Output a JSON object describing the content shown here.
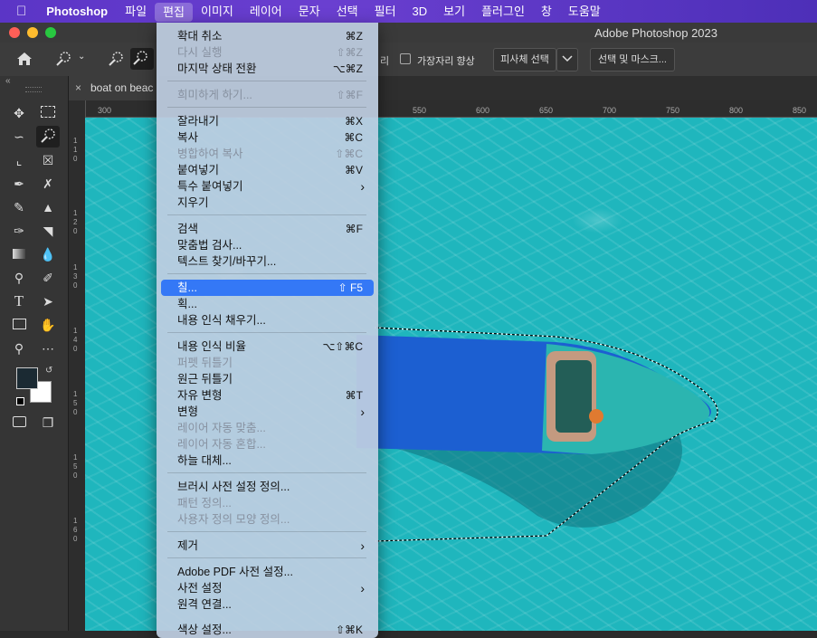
{
  "menubar": {
    "app": "Photoshop",
    "items": [
      "파일",
      "편집",
      "이미지",
      "레이어",
      "문자",
      "선택",
      "필터",
      "3D",
      "보기",
      "플러그인",
      "창",
      "도움말"
    ]
  },
  "window": {
    "title": "Adobe Photoshop 2023"
  },
  "options": {
    "fragment_left": "리",
    "checkbox_label": "가장자리 향상",
    "subject_button": "피사체 선택",
    "mask_button": "선택 및 마스크..."
  },
  "document": {
    "tab_title": "boat on beac",
    "ruler_ticks": [
      "300",
      "550",
      "600",
      "650",
      "700",
      "750",
      "800",
      "850"
    ],
    "left_ruler": [
      "1",
      "1",
      "0",
      "1",
      "2",
      "0",
      "1",
      "3",
      "0",
      "1",
      "4",
      "0",
      "1",
      "5",
      "0",
      "1",
      "5",
      "0",
      "1",
      "6",
      "0"
    ]
  },
  "edit_menu": {
    "items": [
      {
        "label": "확대 취소",
        "shortcut": "⌘Z",
        "disabled": false
      },
      {
        "label": "다시 실행",
        "shortcut": "⇧⌘Z",
        "disabled": true
      },
      {
        "label": "마지막 상태 전환",
        "shortcut": "⌥⌘Z",
        "disabled": false
      },
      {
        "label": "희미하게 하기...",
        "shortcut": "⇧⌘F",
        "disabled": true
      },
      {
        "label": "잘라내기",
        "shortcut": "⌘X",
        "disabled": false
      },
      {
        "label": "복사",
        "shortcut": "⌘C",
        "disabled": false
      },
      {
        "label": "병합하여 복사",
        "shortcut": "⇧⌘C",
        "disabled": true
      },
      {
        "label": "붙여넣기",
        "shortcut": "⌘V",
        "disabled": false
      },
      {
        "label": "특수 붙여넣기",
        "shortcut": "",
        "submenu": true,
        "disabled": false
      },
      {
        "label": "지우기",
        "shortcut": "",
        "disabled": false
      },
      {
        "label": "검색",
        "shortcut": "⌘F",
        "disabled": false
      },
      {
        "label": "맞춤법 검사...",
        "shortcut": "",
        "disabled": false
      },
      {
        "label": "텍스트 찾기/바꾸기...",
        "shortcut": "",
        "disabled": false
      },
      {
        "label": "칠...",
        "shortcut": "⇧ F5",
        "disabled": false,
        "highlighted": true
      },
      {
        "label": "획...",
        "shortcut": "",
        "disabled": false
      },
      {
        "label": "내용 인식 채우기...",
        "shortcut": "",
        "disabled": false
      },
      {
        "label": "내용 인식 비율",
        "shortcut": "⌥⇧⌘C",
        "disabled": false
      },
      {
        "label": "퍼펫 뒤틀기",
        "shortcut": "",
        "disabled": true
      },
      {
        "label": "원근 뒤틀기",
        "shortcut": "",
        "disabled": false
      },
      {
        "label": "자유 변형",
        "shortcut": "⌘T",
        "disabled": false
      },
      {
        "label": "변형",
        "shortcut": "",
        "submenu": true,
        "disabled": false
      },
      {
        "label": "레이어 자동 맞춤...",
        "shortcut": "",
        "disabled": true
      },
      {
        "label": "레이어 자동 혼합...",
        "shortcut": "",
        "disabled": true
      },
      {
        "label": "하늘 대체...",
        "shortcut": "",
        "disabled": false
      },
      {
        "label": "브러시 사전 설정 정의...",
        "shortcut": "",
        "disabled": false
      },
      {
        "label": "패턴 정의...",
        "shortcut": "",
        "disabled": true
      },
      {
        "label": "사용자 정의 모양 정의...",
        "shortcut": "",
        "disabled": true
      },
      {
        "label": "제거",
        "shortcut": "",
        "submenu": true,
        "disabled": false
      },
      {
        "label": "Adobe PDF 사전 설정...",
        "shortcut": "",
        "disabled": false
      },
      {
        "label": "사전 설정",
        "shortcut": "",
        "submenu": true,
        "disabled": false
      },
      {
        "label": "원격 연결...",
        "shortcut": "",
        "disabled": false
      },
      {
        "label": "색상 설정...",
        "shortcut": "⇧⌘K",
        "disabled": false
      }
    ]
  },
  "colors": {
    "menubar": "#5b35c6",
    "highlight": "#3478f6",
    "water": "#1fb6bd",
    "boat_blue": "#1c5fd1"
  }
}
